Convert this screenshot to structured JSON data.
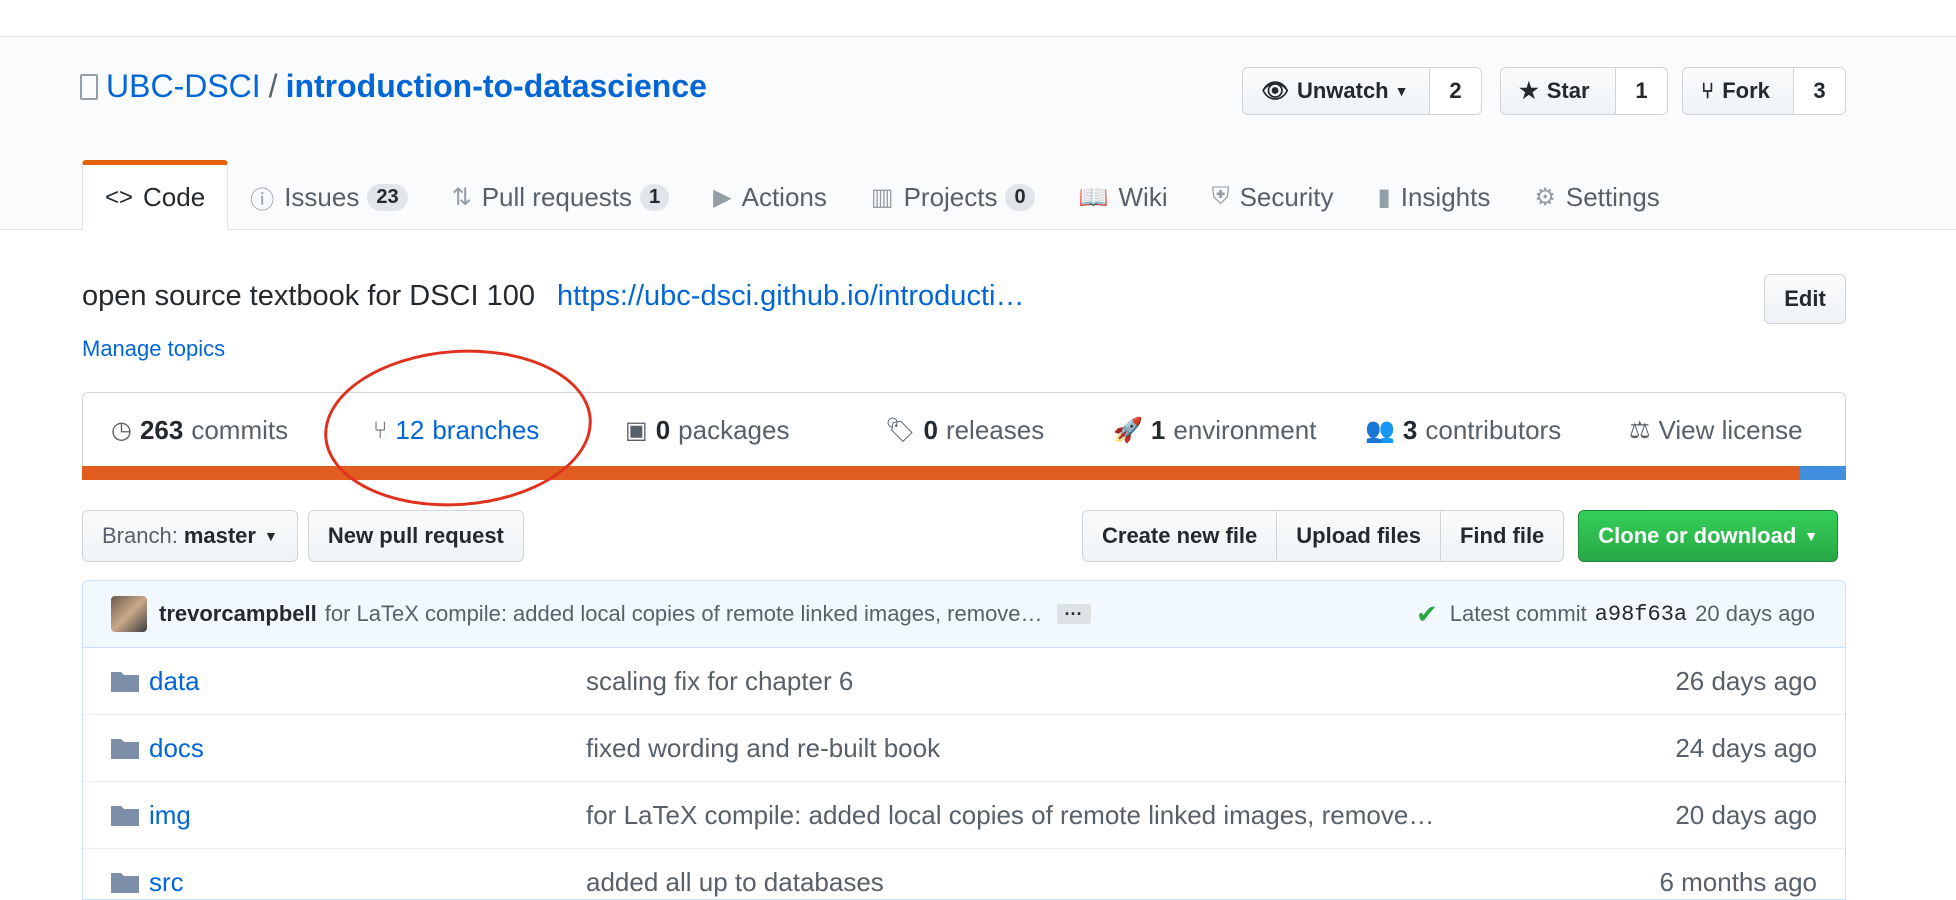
{
  "repo": {
    "owner": "UBC-DSCI",
    "separator": "/",
    "name": "introduction-to-datascience"
  },
  "actions": {
    "watch": {
      "label": "Unwatch",
      "count": "2"
    },
    "star": {
      "label": "Star",
      "count": "1"
    },
    "fork": {
      "label": "Fork",
      "count": "3"
    }
  },
  "tabs": [
    {
      "label": "Code"
    },
    {
      "label": "Issues",
      "badge": "23"
    },
    {
      "label": "Pull requests",
      "badge": "1"
    },
    {
      "label": "Actions"
    },
    {
      "label": "Projects",
      "badge": "0"
    },
    {
      "label": "Wiki"
    },
    {
      "label": "Security"
    },
    {
      "label": "Insights"
    },
    {
      "label": "Settings"
    }
  ],
  "about": {
    "description": "open source textbook for DSCI 100",
    "url": "https://ubc-dsci.github.io/introducti…",
    "manage_topics": "Manage topics",
    "edit_label": "Edit"
  },
  "summary": {
    "commits": {
      "count": "263",
      "label": "commits"
    },
    "branches": {
      "count": "12",
      "label": "branches"
    },
    "packages": {
      "count": "0",
      "label": "packages"
    },
    "releases": {
      "count": "0",
      "label": "releases"
    },
    "environment": {
      "count": "1",
      "label": "environment"
    },
    "contributors": {
      "count": "3",
      "label": "contributors"
    },
    "license": "View license"
  },
  "language_colors": {
    "primary": "#e05d1f",
    "secondary": "#3f8fdc"
  },
  "toolbar": {
    "branch_prefix": "Branch:",
    "branch_name": "master",
    "new_pr": "New pull request",
    "create_file": "Create new file",
    "upload_files": "Upload files",
    "find_file": "Find file",
    "clone": "Clone or download"
  },
  "latest_commit": {
    "author": "trevorcampbell",
    "message": "for LaTeX compile: added local copies of remote linked images, remove…",
    "ellipsis": "···",
    "prefix": "Latest commit",
    "sha": "a98f63a",
    "age": "20 days ago"
  },
  "files": [
    {
      "name": "data",
      "message": "scaling fix for chapter 6",
      "age": "26 days ago"
    },
    {
      "name": "docs",
      "message": "fixed wording and re-built book",
      "age": "24 days ago"
    },
    {
      "name": "img",
      "message": "for LaTeX compile: added local copies of remote linked images, remove…",
      "age": "20 days ago"
    },
    {
      "name": "src",
      "message": "added all up to databases",
      "age": "6 months ago"
    }
  ],
  "highlight_color": "#e0301e"
}
